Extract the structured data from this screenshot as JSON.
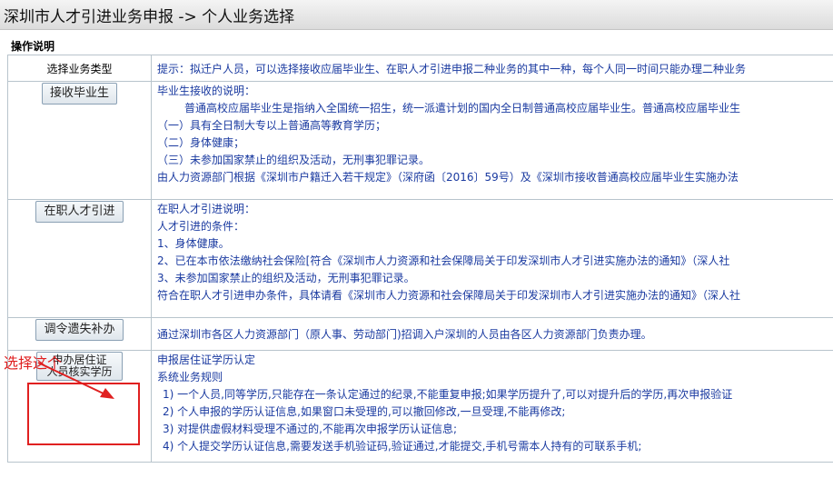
{
  "title": "深圳市人才引进业务申报 -> 个人业务选择",
  "section_label": "操作说明",
  "header": {
    "left": "选择业务类型",
    "right": "提示：拟迁户人员，可以选择接收应届毕业生、在职人才引进申报二种业务的其中一种，每个人同一时间只能办理二种业务"
  },
  "rows": [
    {
      "button": "接收毕业生",
      "lines": [
        "毕业生接收的说明：",
        "普通高校应届毕业生是指纳入全国统一招生，统一派遣计划的国内全日制普通高校应届毕业生。普通高校应届毕业生",
        "（一）具有全日制大专以上普通高等教育学历；",
        "（二）身体健康；",
        "（三）未参加国家禁止的组织及活动，无刑事犯罪记录。",
        "由人力资源部门根据《深圳市户籍迁入若干规定》（深府函〔2016〕59号）及《深圳市接收普通高校应届毕业生实施办法"
      ]
    },
    {
      "button": "在职人才引进",
      "lines": [
        "在职人才引进说明：",
        "人才引进的条件：",
        "1、身体健康。",
        "2、已在本市依法缴纳社会保险[符合《深圳市人力资源和社会保障局关于印发深圳市人才引进实施办法的通知》（深人社",
        "3、未参加国家禁止的组织及活动，无刑事犯罪记录。",
        "符合在职人才引进申办条件，具体请看《深圳市人力资源和社会保障局关于印发深圳市人才引进实施办法的通知》（深人社"
      ]
    },
    {
      "button": "调令遗失补办",
      "lines": [
        "通过深圳市各区人力资源部门（原人事、劳动部门)招调入户深圳的人员由各区人力资源部门负责办理。"
      ]
    },
    {
      "button_line1": "申办居住证",
      "button_line2": "人员核实学历",
      "lines": [
        "申报居住证学历认定",
        "系统业务规则",
        "1) 一个人员,同等学历,只能存在一条认定通过的纪录,不能重复申报;如果学历提升了,可以对提升后的学历,再次申报验证",
        "2) 个人申报的学历认证信息,如果窗口未受理的,可以撤回修改,一旦受理,不能再修改;",
        "3) 对提供虚假材料受理不通过的,不能再次申报学历认证信息;",
        "4) 个人提交学历认证信息,需要发送手机验证码,验证通过,才能提交,手机号需本人持有的可联系手机;"
      ]
    }
  ],
  "annotation": "选择这个",
  "annotation_color": "#e02020",
  "link_color": "#1a3aa0"
}
